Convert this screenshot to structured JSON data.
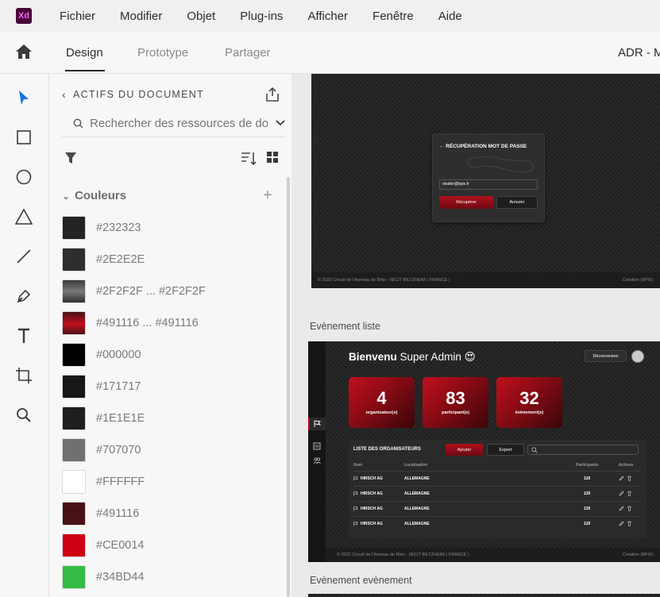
{
  "app": {
    "logo_text": "Xd",
    "menu": [
      "Fichier",
      "Modifier",
      "Objet",
      "Plug-ins",
      "Afficher",
      "Fenêtre",
      "Aide"
    ]
  },
  "tabs": {
    "design": "Design",
    "prototype": "Prototype",
    "share": "Partager",
    "document_title": "ADR - M"
  },
  "assets": {
    "header": "ACTIFS DU DOCUMENT",
    "search_placeholder": "Rechercher des ressources de do",
    "colors_title": "Couleurs",
    "colors": [
      {
        "label": "#232323",
        "hex": "#232323"
      },
      {
        "label": "#2E2E2E",
        "hex": "#2E2E2E"
      },
      {
        "label": "#2F2F2F ... #2F2F2F",
        "hex": "gradient-gray"
      },
      {
        "label": "#491116 ... #491116",
        "hex": "gradient-red"
      },
      {
        "label": "#000000",
        "hex": "#000000"
      },
      {
        "label": "#171717",
        "hex": "#171717"
      },
      {
        "label": "#1E1E1E",
        "hex": "#1E1E1E"
      },
      {
        "label": "#707070",
        "hex": "#707070"
      },
      {
        "label": "#FFFFFF",
        "hex": "#FFFFFF"
      },
      {
        "label": "#491116",
        "hex": "#491116"
      },
      {
        "label": "#CE0014",
        "hex": "#CE0014"
      },
      {
        "label": "#34BD44",
        "hex": "#34BD44"
      },
      {
        "label": "",
        "hex": "#E8604A"
      }
    ]
  },
  "canvas": {
    "password_artboard": {
      "modal_title": "← RÉCUPÉRATION MOT DE PASSE",
      "email_value": "shatler@bpix.fr",
      "recover_button": "Récupérer",
      "cancel_button": "Annuler",
      "footer_left": "© 2022 Circuit de l'Anneau du Rhin - 68127 BILTZHEIM ( FRANCE )",
      "footer_right": "Création ⟨BPIX⟩"
    },
    "event_list_label": "Evènement liste",
    "dashboard": {
      "welcome_bold": "Bienvenu",
      "welcome_rest": "Super Admin 😍",
      "logout_button": "Déconnexion",
      "stats": [
        {
          "value": "4",
          "label": "organisateur(s)"
        },
        {
          "value": "83",
          "label": "participant(s)"
        },
        {
          "value": "32",
          "label": "évènement(s)"
        }
      ],
      "table_title": "LISTE DES ORGANISATEURS",
      "add_button": "Ajouter",
      "export_button": "Export",
      "columns": [
        "Nom",
        "Localisation",
        "Participants",
        "Actions"
      ],
      "rows": [
        {
          "name": "HIRSCH AG",
          "location": "ALLEMAGNE",
          "participants": "120"
        },
        {
          "name": "HIRSCH AG",
          "location": "ALLEMAGNE",
          "participants": "120"
        },
        {
          "name": "HIRSCH AG",
          "location": "ALLEMAGNE",
          "participants": "120"
        },
        {
          "name": "HIRSCH AG",
          "location": "ALLEMAGNE",
          "participants": "120"
        }
      ],
      "footer_left": "© 2022 Circuit de l'Anneau du Rhin - 68127 BILTZHEIM ( FRANCE )",
      "footer_right": "Création ⟨BPIX⟩"
    },
    "event_event_label": "Evènement evènement"
  },
  "colors": {
    "accent_blue": "#1473e6",
    "brand_red": "#CE0014"
  }
}
